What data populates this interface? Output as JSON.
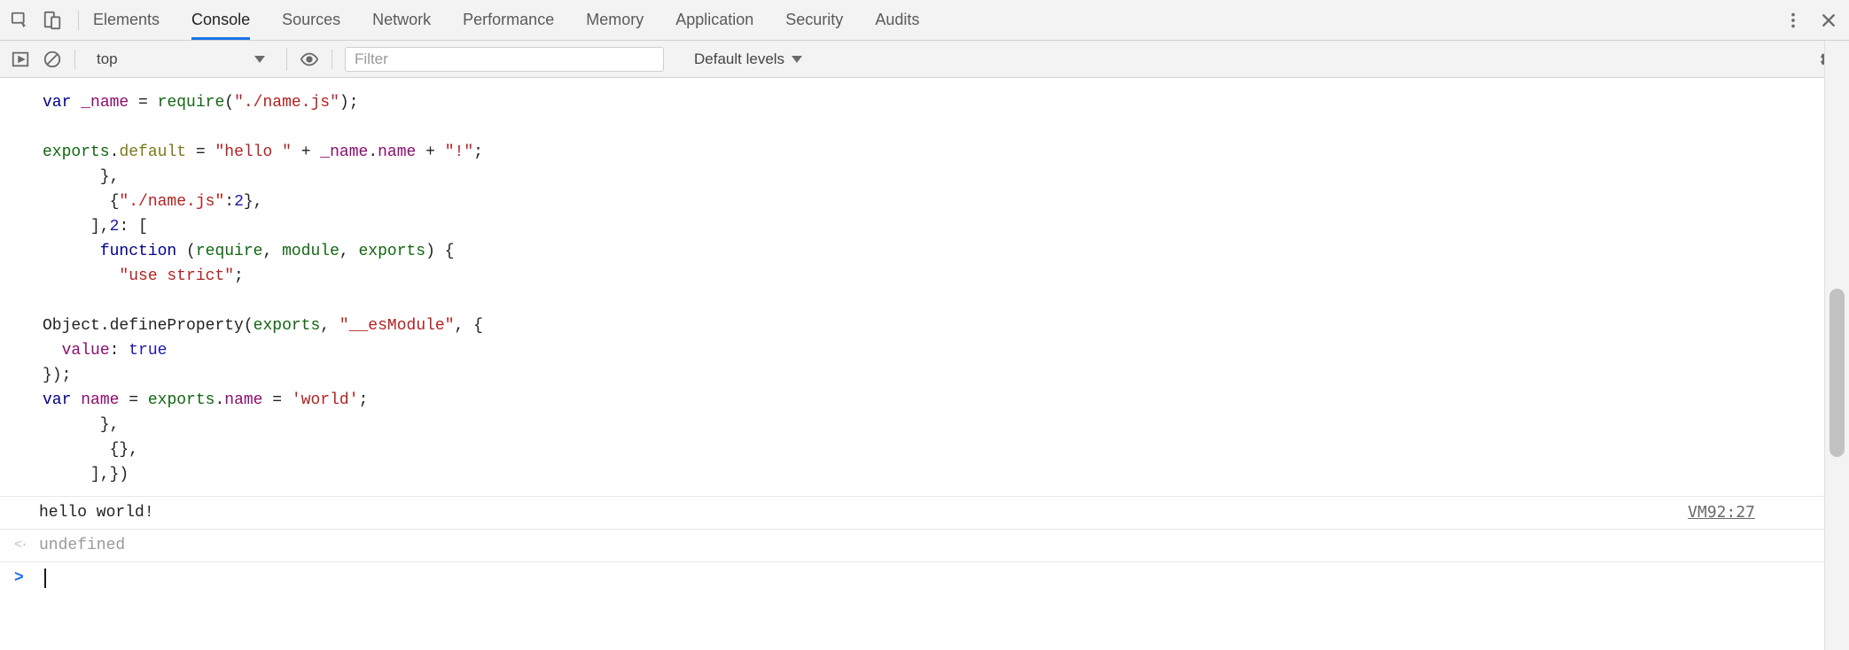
{
  "app": "Chrome DevTools",
  "tabs": [
    {
      "label": "Elements",
      "active": false
    },
    {
      "label": "Console",
      "active": true
    },
    {
      "label": "Sources",
      "active": false
    },
    {
      "label": "Network",
      "active": false
    },
    {
      "label": "Performance",
      "active": false
    },
    {
      "label": "Memory",
      "active": false
    },
    {
      "label": "Application",
      "active": false
    },
    {
      "label": "Security",
      "active": false
    },
    {
      "label": "Audits",
      "active": false
    }
  ],
  "toolbar": {
    "context": "top",
    "filter_placeholder": "Filter",
    "filter_value": "",
    "level": "Default levels"
  },
  "code_tokens": {
    "var1": "var",
    "name_id": "_name",
    "eq": " = ",
    "req": "require",
    "path1": "\"./name.js\"",
    "semi": ";",
    "exports": "exports",
    "default": "default",
    "hello": "\"hello \"",
    "dotname": "name",
    "bang": "\"!\"",
    "path1b": "\"./name.js\"",
    "two": "2",
    "function": "function",
    "reqp": "require",
    "modp": "module",
    "expp": "exports",
    "use_strict": "\"use strict\"",
    "object": "Object",
    "defprop": "defineProperty",
    "esmod": "\"__esModule\"",
    "value": "value",
    "true": "true",
    "var2": "var",
    "name2": "name",
    "world": "'world'"
  },
  "console": {
    "log_message": "hello world!",
    "log_source": "VM92:27",
    "return_value": "undefined"
  }
}
